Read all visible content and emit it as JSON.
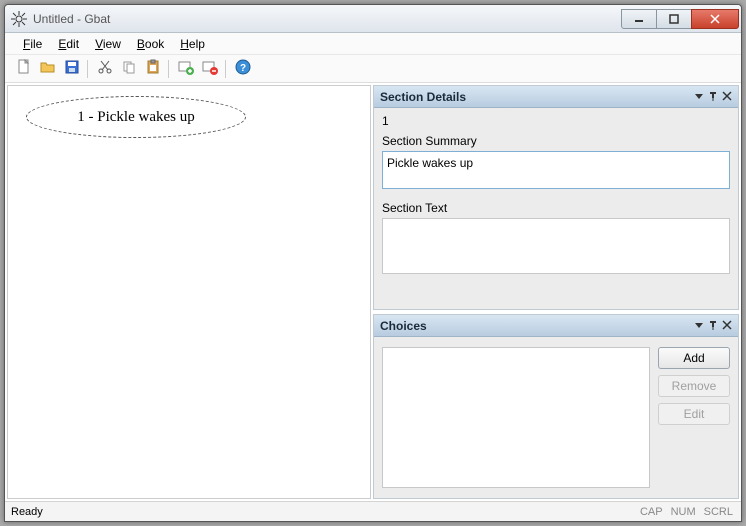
{
  "window": {
    "title": "Untitled - Gbat"
  },
  "menu": {
    "file": "File",
    "edit": "Edit",
    "view": "View",
    "book": "Book",
    "help": "Help"
  },
  "canvas": {
    "node1_label": "1 - Pickle wakes up"
  },
  "details": {
    "panel_title": "Section Details",
    "section_id": "1",
    "summary_label": "Section Summary",
    "summary_value": "Pickle wakes up",
    "text_label": "Section Text",
    "text_value": ""
  },
  "choices": {
    "panel_title": "Choices",
    "add": "Add",
    "remove": "Remove",
    "edit": "Edit"
  },
  "status": {
    "left": "Ready",
    "cap": "CAP",
    "num": "NUM",
    "scrl": "SCRL"
  }
}
